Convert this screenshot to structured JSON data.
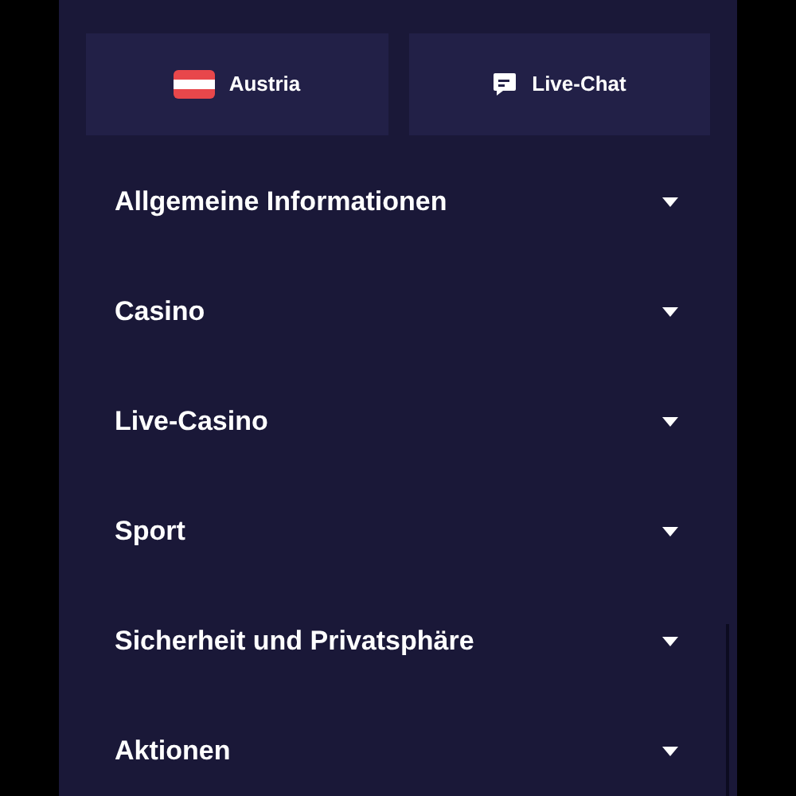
{
  "buttons": [
    {
      "kind": "flag",
      "label": "Austria"
    },
    {
      "kind": "chat",
      "label": "Live-Chat"
    }
  ],
  "sections": [
    {
      "label": "Allgemeine Informationen",
      "expanded": false
    },
    {
      "label": "Casino",
      "expanded": false
    },
    {
      "label": "Live-Casino",
      "expanded": false
    },
    {
      "label": "Sport",
      "expanded": false
    },
    {
      "label": "Sicherheit und Privatsphäre",
      "expanded": false
    },
    {
      "label": "Aktionen",
      "expanded": false
    }
  ]
}
